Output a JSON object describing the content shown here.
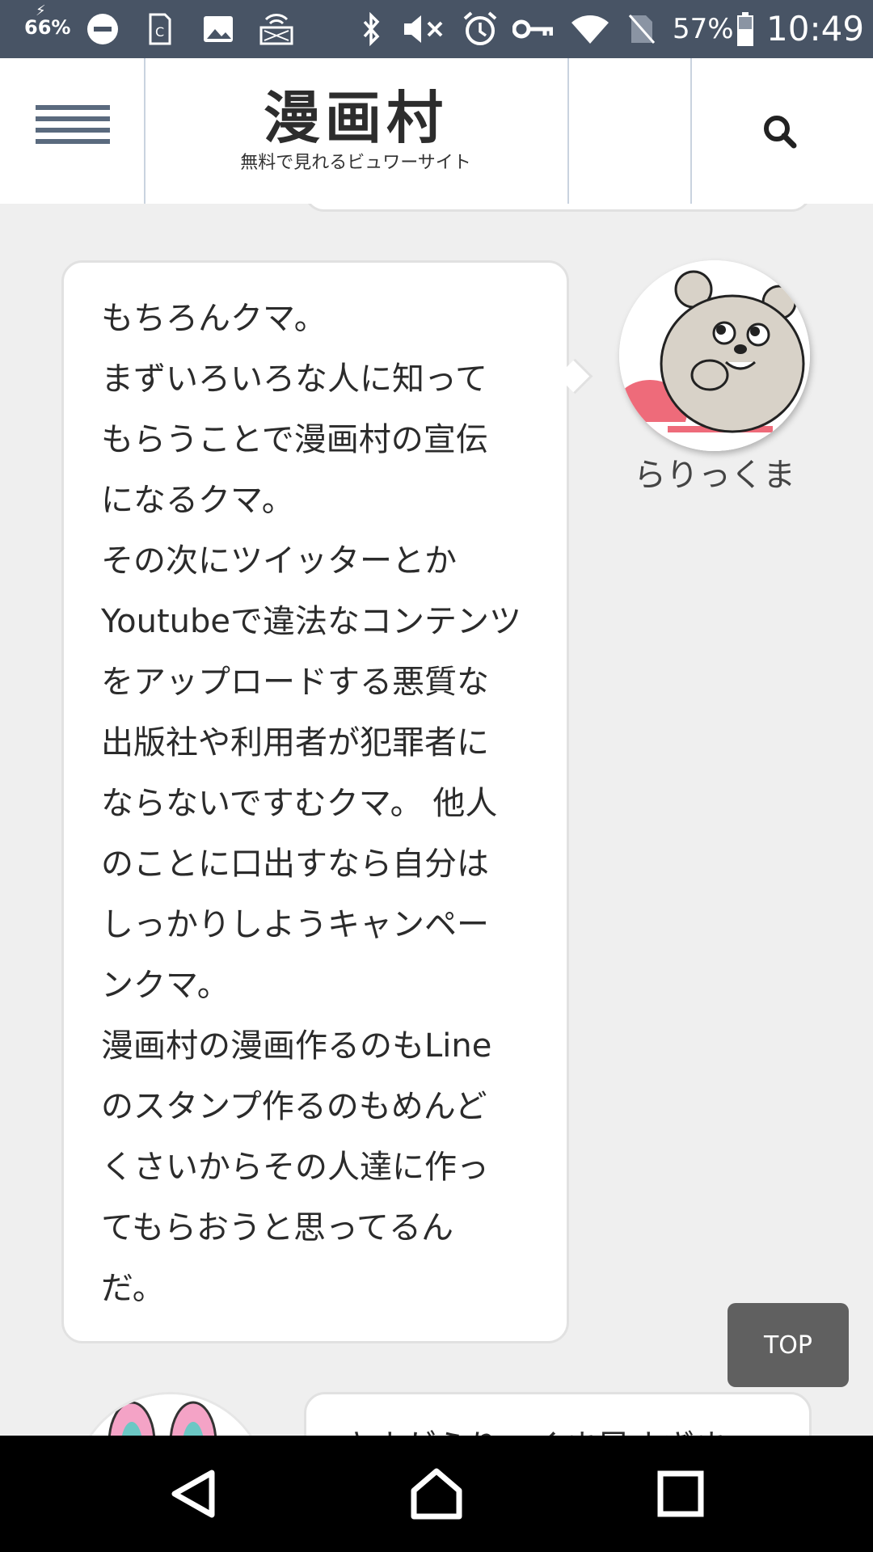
{
  "status_bar": {
    "left_badge": "66%",
    "battery_percent": "57%",
    "time": "10:49",
    "icons": [
      "data-saver-icon",
      "dnd-icon",
      "sim-icon",
      "image-icon",
      "cast-icon",
      "bluetooth-icon",
      "mute-icon",
      "alarm-icon",
      "vpn-key-icon",
      "wifi-icon",
      "no-sim-icon",
      "battery-icon"
    ]
  },
  "header": {
    "title": "漫画村",
    "subtitle": "無料で見れるビュワーサイト",
    "menu_icon": "hamburger-menu-icon",
    "search_icon": "search-icon"
  },
  "conversation": {
    "message": {
      "author": "らりっくま",
      "text": "もちろんクマ。\nまずいろいろな人に知って\nもらうことで漫画村の宣伝\nになるクマ。\nその次にツイッターとか\nYoutubeで違法なコンテンツ\nをアップロードする悪質な\n出版社や利用者が犯罪者に\nならないですむクマ。 他人\nのことに口出すなら自分は\nしっかりしようキャンペー\nンクマ。\n漫画村の漫画作るのもLine\nのスタンプ作るのもめんど\nくさいからその人達に作っ\nてもらおうと思ってるん\nだ。",
      "avatar_icon": "bear-avatar-icon"
    },
    "next_message_preview": "さすがらりっくま早すぎま"
  },
  "top_button": {
    "label": "TOP"
  },
  "nav_bar": {
    "back_icon": "back-triangle-icon",
    "home_icon": "home-icon",
    "recents_icon": "recents-square-icon"
  }
}
